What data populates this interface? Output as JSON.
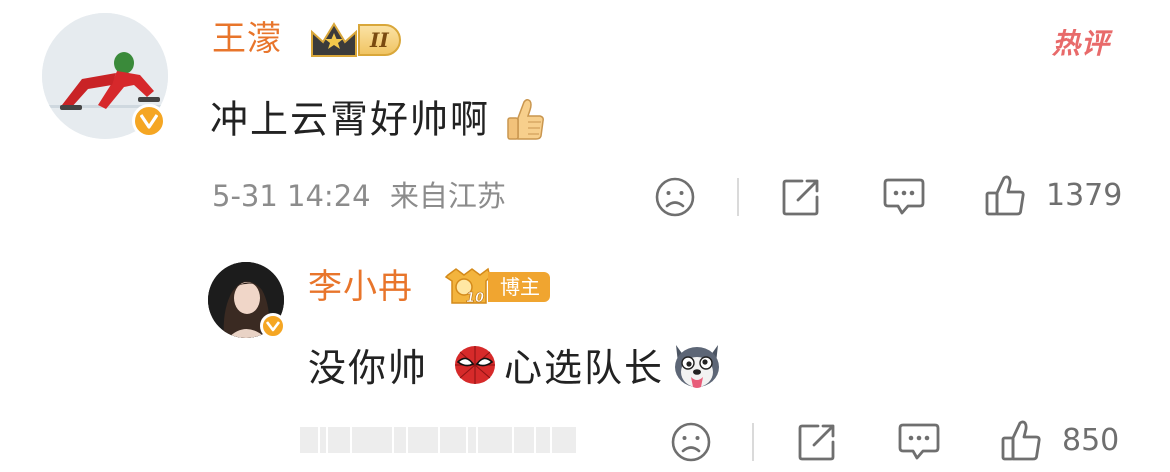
{
  "comment": {
    "username": "王濛",
    "level_badge_text": "II",
    "hot_tag": "热评",
    "text": "冲上云霄好帅啊",
    "emoji": "thumbs-up-emoji",
    "date": "5-31 14:24",
    "location": "来自江苏",
    "like_count": "1379",
    "icons": [
      "sad-face-icon",
      "share-icon",
      "comment-icon",
      "like-icon"
    ]
  },
  "reply": {
    "username": "李小冉",
    "badge_level": "10",
    "badge_label": "博主",
    "text_part1": "没你帅",
    "text_part2": "心选队长",
    "emojis": [
      "spiderman-emoji",
      "husky-emoji"
    ],
    "like_count": "850",
    "icons": [
      "sad-face-icon",
      "share-icon",
      "comment-icon",
      "like-icon"
    ]
  },
  "colors": {
    "username": "#e8752b",
    "hot_tag": "#e86a6a",
    "verified_badge": "#f5a623",
    "meta_text": "#8c8c8c"
  }
}
